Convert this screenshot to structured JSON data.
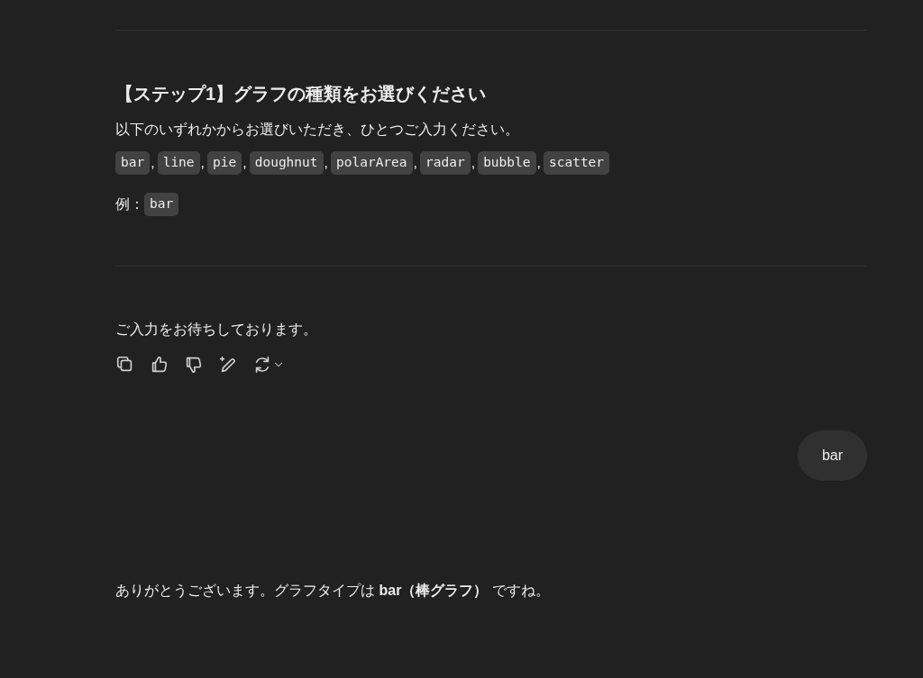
{
  "step": {
    "heading": "【ステップ1】グラフの種類をお選びください",
    "instruction": "以下のいずれかからお選びいただき、ひとつご入力ください。",
    "options": [
      {
        "code": "bar",
        "separator": ","
      },
      {
        "code": "line",
        "separator": ","
      },
      {
        "code": "pie",
        "separator": ","
      },
      {
        "code": "doughnut",
        "separator": ","
      },
      {
        "code": "polarArea",
        "separator": ","
      },
      {
        "code": "radar",
        "separator": ","
      },
      {
        "code": "bubble",
        "separator": ","
      },
      {
        "code": "scatter"
      }
    ],
    "example_label": "例：",
    "example_code": "bar"
  },
  "waiting": "ご入力をお待ちしております。",
  "actions": [
    {
      "kind": "copy"
    },
    {
      "kind": "like"
    },
    {
      "kind": "dislike"
    },
    {
      "kind": "edit"
    },
    {
      "kind": "regenerate"
    }
  ],
  "user_message": "bar",
  "reply": "ありがとうございます。グラフタイプは **bar（棒グラフ）** ですね。"
}
